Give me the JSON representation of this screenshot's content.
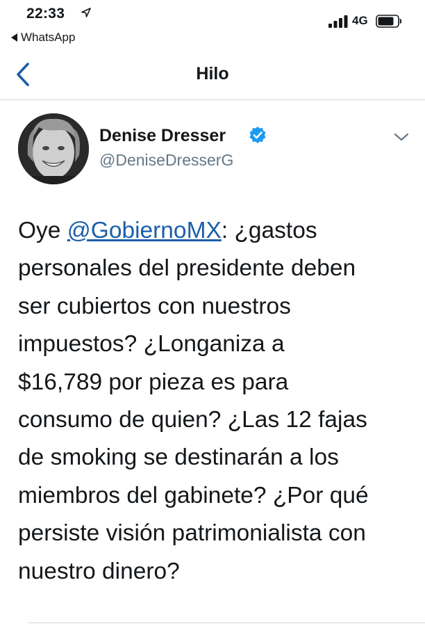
{
  "status_bar": {
    "time": "22:33",
    "back_app": "WhatsApp",
    "network": "4G"
  },
  "nav": {
    "title": "Hilo"
  },
  "tweet": {
    "author": {
      "name": "Denise Dresser",
      "handle": "@DeniseDresserG"
    },
    "text_lines": [
      {
        "pre": "Oye ",
        "mention": "@GobiernoMX",
        "post": ": ¿gastos"
      },
      "personales del presidente deben",
      "ser cubiertos con nuestros",
      "impuestos? ¿Longaniza a",
      "$16,789 por pieza es para",
      "consumo de quien? ¿Las 12 fajas",
      "de smoking se destinarán a los",
      "miembros del gabinete? ¿Por qué",
      "persiste visión patrimonialista con",
      "nuestro dinero?"
    ]
  },
  "colors": {
    "text": "#14171a",
    "secondary": "#657786",
    "link": "#1b5fa8",
    "verified": "#1d9bf0",
    "divider": "#cfd4d9"
  }
}
